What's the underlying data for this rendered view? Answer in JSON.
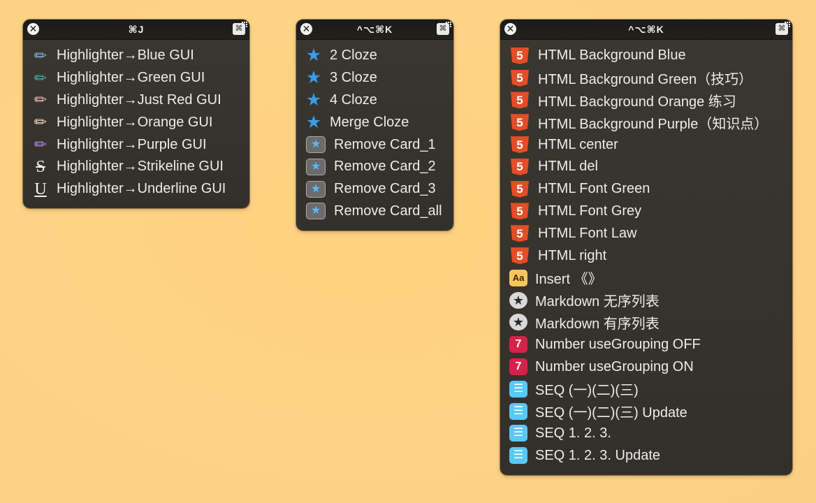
{
  "panels": [
    {
      "hotkey": "⌘J",
      "close_glyph": "✕",
      "kbd_glyph": "⌘",
      "items": [
        {
          "label": "Highlighter→Blue GUI",
          "icon": "blue-highlighter-icon",
          "glyph": "✏",
          "color": "#8ab8f0"
        },
        {
          "label": "Highlighter→Green GUI",
          "icon": "green-highlighter-icon",
          "glyph": "✏",
          "color": "#3db6b0"
        },
        {
          "label": "Highlighter→Just Red GUI",
          "icon": "red-highlighter-icon",
          "glyph": "✏",
          "color": "#f2c0bc"
        },
        {
          "label": "Highlighter→Orange GUI",
          "icon": "orange-highlighter-icon",
          "glyph": "✏",
          "color": "#f7dcc2"
        },
        {
          "label": "Highlighter→Purple GUI",
          "icon": "purple-highlighter-icon",
          "glyph": "✏",
          "color": "#b08ef0"
        },
        {
          "label": "Highlighter→Strikeline GUI",
          "icon": "strikethrough-icon",
          "glyph": "S"
        },
        {
          "label": "Highlighter→Underline GUI",
          "icon": "underline-icon",
          "glyph": "U"
        }
      ]
    },
    {
      "hotkey": "^⌥⌘K",
      "close_glyph": "✕",
      "kbd_glyph": "⌘",
      "items": [
        {
          "label": "2 Cloze",
          "icon": "star-icon",
          "glyph": "★"
        },
        {
          "label": "3 Cloze",
          "icon": "star-icon",
          "glyph": "★"
        },
        {
          "label": "4 Cloze",
          "icon": "star-icon",
          "glyph": "★"
        },
        {
          "label": "Merge Cloze",
          "icon": "star-icon",
          "glyph": "★"
        },
        {
          "label": "Remove Card_1",
          "icon": "remove-card-icon",
          "glyph": "★"
        },
        {
          "label": "Remove Card_2",
          "icon": "remove-card-icon",
          "glyph": "★"
        },
        {
          "label": "Remove Card_3",
          "icon": "remove-card-icon",
          "glyph": "★"
        },
        {
          "label": "Remove Card_all",
          "icon": "remove-card-icon",
          "glyph": "★"
        }
      ]
    },
    {
      "hotkey": "^⌥⌘K",
      "close_glyph": "✕",
      "kbd_glyph": "⌘",
      "items": [
        {
          "label": "HTML Background Blue",
          "icon": "html5-icon",
          "glyph": "5"
        },
        {
          "label": "HTML Background Green（技巧）",
          "icon": "html5-icon",
          "glyph": "5"
        },
        {
          "label": "HTML Background Orange 练习",
          "icon": "html5-icon",
          "glyph": "5"
        },
        {
          "label": "HTML Background Purple（知识点）",
          "icon": "html5-icon",
          "glyph": "5"
        },
        {
          "label": "HTML center",
          "icon": "html5-icon",
          "glyph": "5"
        },
        {
          "label": "HTML del",
          "icon": "html5-icon",
          "glyph": "5"
        },
        {
          "label": "HTML Font Green",
          "icon": "html5-icon",
          "glyph": "5"
        },
        {
          "label": "HTML Font Grey",
          "icon": "html5-icon",
          "glyph": "5"
        },
        {
          "label": "HTML Font Law",
          "icon": "html5-icon",
          "glyph": "5"
        },
        {
          "label": "HTML right",
          "icon": "html5-icon",
          "glyph": "5"
        },
        {
          "label": "Insert 《》",
          "icon": "text-aa-icon",
          "glyph": "Aa"
        },
        {
          "label": "Markdown 无序列表",
          "icon": "star-circle-icon",
          "glyph": "★"
        },
        {
          "label": "Markdown 有序列表",
          "icon": "star-circle-icon",
          "glyph": "★"
        },
        {
          "label": "Number useGrouping OFF",
          "icon": "number-seven-icon",
          "glyph": "7"
        },
        {
          "label": "Number useGrouping ON",
          "icon": "number-seven-icon",
          "glyph": "7"
        },
        {
          "label": "SEQ (一)(二)(三)",
          "icon": "list-icon",
          "glyph": "☰"
        },
        {
          "label": "SEQ (一)(二)(三) Update",
          "icon": "list-icon",
          "glyph": "☰"
        },
        {
          "label": "SEQ 1. 2. 3.",
          "icon": "list-icon",
          "glyph": "☰"
        },
        {
          "label": "SEQ 1. 2. 3. Update",
          "icon": "list-icon",
          "glyph": "☰"
        }
      ]
    }
  ]
}
